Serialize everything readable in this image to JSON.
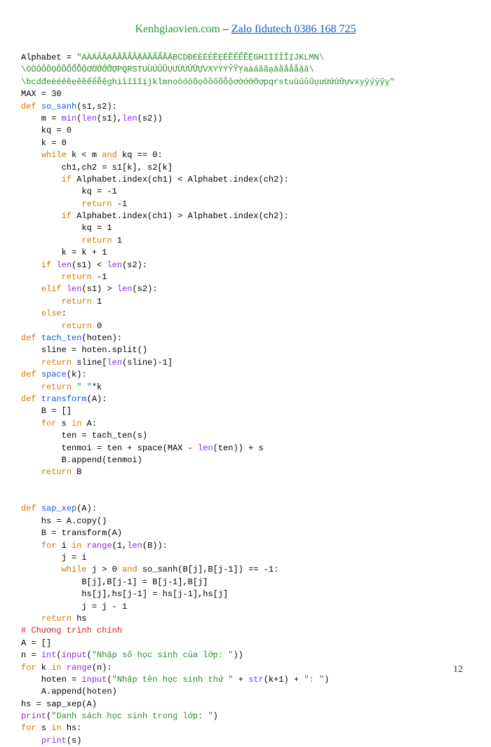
{
  "header": {
    "site": "Kenhgiaovien.com",
    "dash": " – ",
    "zalo": "Zalo fidutech 0386 168 725"
  },
  "code": {
    "tokens": [
      {
        "c": "s-plain",
        "t": "Alphabet = "
      },
      {
        "c": "s-str",
        "t": "\"AÀÁẢÃẠĂẰẮẲẴẶÂẦẤẨẪẬBCDĐEÈÉẺẼẸÊỀẾỂỄỆGHIÌÍỈĨỊJKLMN\\"
      },
      {
        "c": "nl"
      },
      {
        "c": "s-str",
        "t": "\\OÒÓỎÕỌÔỒỐỔỖỘƠỜỚỞỠỢPQRSTUÙÚỦŨỤƯỪỨỬỮỰVXYỲÝỶỸỴaàáảãạăằắẳẵặâ\\"
      },
      {
        "c": "nl"
      },
      {
        "c": "s-str",
        "t": "\\bcdđeèéẻẽẹêềếểễệghiìíỉĩịjklmnoòóỏõọôồốổỗộơờớởỡợpqrstuùúủũụưừứửữựvxyỳýỷỹỵ\""
      },
      {
        "c": "nl"
      },
      {
        "c": "s-plain",
        "t": "MAX = 30"
      },
      {
        "c": "nl"
      },
      {
        "c": "s-kw",
        "t": "def"
      },
      {
        "c": "s-plain",
        "t": " "
      },
      {
        "c": "s-fn",
        "t": "so_sanh"
      },
      {
        "c": "s-plain",
        "t": "(s1,s2):"
      },
      {
        "c": "nl"
      },
      {
        "c": "s-plain",
        "t": "    m = "
      },
      {
        "c": "s-bi",
        "t": "min"
      },
      {
        "c": "s-plain",
        "t": "("
      },
      {
        "c": "s-bi",
        "t": "len"
      },
      {
        "c": "s-plain",
        "t": "(s1),"
      },
      {
        "c": "s-bi",
        "t": "len"
      },
      {
        "c": "s-plain",
        "t": "(s2))"
      },
      {
        "c": "nl"
      },
      {
        "c": "s-plain",
        "t": "    kq = 0"
      },
      {
        "c": "nl"
      },
      {
        "c": "s-plain",
        "t": "    k = 0"
      },
      {
        "c": "nl"
      },
      {
        "c": "s-plain",
        "t": "    "
      },
      {
        "c": "s-kw",
        "t": "while"
      },
      {
        "c": "s-plain",
        "t": " k < m "
      },
      {
        "c": "s-kw",
        "t": "and"
      },
      {
        "c": "s-plain",
        "t": " kq == 0:"
      },
      {
        "c": "nl"
      },
      {
        "c": "s-plain",
        "t": "        ch1,ch2 = s1[k], s2[k]"
      },
      {
        "c": "nl"
      },
      {
        "c": "s-plain",
        "t": "        "
      },
      {
        "c": "s-kw",
        "t": "if"
      },
      {
        "c": "s-plain",
        "t": " Alphabet.index(ch1) < Alphabet.index(ch2):"
      },
      {
        "c": "nl"
      },
      {
        "c": "s-plain",
        "t": "            kq = -1"
      },
      {
        "c": "nl"
      },
      {
        "c": "s-plain",
        "t": "            "
      },
      {
        "c": "s-kw",
        "t": "return"
      },
      {
        "c": "s-plain",
        "t": " -1"
      },
      {
        "c": "nl"
      },
      {
        "c": "s-plain",
        "t": "        "
      },
      {
        "c": "s-kw",
        "t": "if"
      },
      {
        "c": "s-plain",
        "t": " Alphabet.index(ch1) > Alphabet.index(ch2):"
      },
      {
        "c": "nl"
      },
      {
        "c": "s-plain",
        "t": "            kq = 1"
      },
      {
        "c": "nl"
      },
      {
        "c": "s-plain",
        "t": "            "
      },
      {
        "c": "s-kw",
        "t": "return"
      },
      {
        "c": "s-plain",
        "t": " 1"
      },
      {
        "c": "nl"
      },
      {
        "c": "s-plain",
        "t": "        k = k + 1"
      },
      {
        "c": "nl"
      },
      {
        "c": "s-plain",
        "t": "    "
      },
      {
        "c": "s-kw",
        "t": "if"
      },
      {
        "c": "s-plain",
        "t": " "
      },
      {
        "c": "s-bi",
        "t": "len"
      },
      {
        "c": "s-plain",
        "t": "(s1) < "
      },
      {
        "c": "s-bi",
        "t": "len"
      },
      {
        "c": "s-plain",
        "t": "(s2):"
      },
      {
        "c": "nl"
      },
      {
        "c": "s-plain",
        "t": "        "
      },
      {
        "c": "s-kw",
        "t": "return"
      },
      {
        "c": "s-plain",
        "t": " -1"
      },
      {
        "c": "nl"
      },
      {
        "c": "s-plain",
        "t": "    "
      },
      {
        "c": "s-kw",
        "t": "elif"
      },
      {
        "c": "s-plain",
        "t": " "
      },
      {
        "c": "s-bi",
        "t": "len"
      },
      {
        "c": "s-plain",
        "t": "(s1) > "
      },
      {
        "c": "s-bi",
        "t": "len"
      },
      {
        "c": "s-plain",
        "t": "(s2):"
      },
      {
        "c": "nl"
      },
      {
        "c": "s-plain",
        "t": "        "
      },
      {
        "c": "s-kw",
        "t": "return"
      },
      {
        "c": "s-plain",
        "t": " 1"
      },
      {
        "c": "nl"
      },
      {
        "c": "s-plain",
        "t": "    "
      },
      {
        "c": "s-kw",
        "t": "else"
      },
      {
        "c": "s-plain",
        "t": ":"
      },
      {
        "c": "nl"
      },
      {
        "c": "s-plain",
        "t": "        "
      },
      {
        "c": "s-kw",
        "t": "return"
      },
      {
        "c": "s-plain",
        "t": " 0"
      },
      {
        "c": "nl"
      },
      {
        "c": "s-kw",
        "t": "def"
      },
      {
        "c": "s-plain",
        "t": " "
      },
      {
        "c": "s-fn",
        "t": "tach_ten"
      },
      {
        "c": "s-plain",
        "t": "(hoten):"
      },
      {
        "c": "nl"
      },
      {
        "c": "s-plain",
        "t": "    sline = hoten.split()"
      },
      {
        "c": "nl"
      },
      {
        "c": "s-plain",
        "t": "    "
      },
      {
        "c": "s-kw",
        "t": "return"
      },
      {
        "c": "s-plain",
        "t": " sline["
      },
      {
        "c": "s-bi",
        "t": "len"
      },
      {
        "c": "s-plain",
        "t": "(sline)-1]"
      },
      {
        "c": "nl"
      },
      {
        "c": "s-kw",
        "t": "def"
      },
      {
        "c": "s-plain",
        "t": " "
      },
      {
        "c": "s-fn",
        "t": "space"
      },
      {
        "c": "s-plain",
        "t": "(k):"
      },
      {
        "c": "nl"
      },
      {
        "c": "s-plain",
        "t": "    "
      },
      {
        "c": "s-kw",
        "t": "return"
      },
      {
        "c": "s-plain",
        "t": " "
      },
      {
        "c": "s-str",
        "t": "\" \""
      },
      {
        "c": "s-plain",
        "t": "*k"
      },
      {
        "c": "nl"
      },
      {
        "c": "s-kw",
        "t": "def"
      },
      {
        "c": "s-plain",
        "t": " "
      },
      {
        "c": "s-fn",
        "t": "transform"
      },
      {
        "c": "s-plain",
        "t": "(A):"
      },
      {
        "c": "nl"
      },
      {
        "c": "s-plain",
        "t": "    B = []"
      },
      {
        "c": "nl"
      },
      {
        "c": "s-plain",
        "t": "    "
      },
      {
        "c": "s-kw",
        "t": "for"
      },
      {
        "c": "s-plain",
        "t": " s "
      },
      {
        "c": "s-kw",
        "t": "in"
      },
      {
        "c": "s-plain",
        "t": " A:"
      },
      {
        "c": "nl"
      },
      {
        "c": "s-plain",
        "t": "        ten = tach_ten(s)"
      },
      {
        "c": "nl"
      },
      {
        "c": "s-plain",
        "t": "        tenmoi = ten + space(MAX - "
      },
      {
        "c": "s-bi",
        "t": "len"
      },
      {
        "c": "s-plain",
        "t": "(ten)) + s"
      },
      {
        "c": "nl"
      },
      {
        "c": "s-plain",
        "t": "        B.append(tenmoi)"
      },
      {
        "c": "nl"
      },
      {
        "c": "s-plain",
        "t": "    "
      },
      {
        "c": "s-kw",
        "t": "return"
      },
      {
        "c": "s-plain",
        "t": " B"
      },
      {
        "c": "nl"
      },
      {
        "c": "nl"
      },
      {
        "c": "nl"
      },
      {
        "c": "s-kw",
        "t": "def"
      },
      {
        "c": "s-plain",
        "t": " "
      },
      {
        "c": "s-fn",
        "t": "sap_xep"
      },
      {
        "c": "s-plain",
        "t": "(A):"
      },
      {
        "c": "nl"
      },
      {
        "c": "s-plain",
        "t": "    hs = A.copy()"
      },
      {
        "c": "nl"
      },
      {
        "c": "s-plain",
        "t": "    B = transform(A)"
      },
      {
        "c": "nl"
      },
      {
        "c": "s-plain",
        "t": "    "
      },
      {
        "c": "s-kw",
        "t": "for"
      },
      {
        "c": "s-plain",
        "t": " i "
      },
      {
        "c": "s-kw",
        "t": "in"
      },
      {
        "c": "s-plain",
        "t": " "
      },
      {
        "c": "s-bi",
        "t": "range"
      },
      {
        "c": "s-plain",
        "t": "(1,"
      },
      {
        "c": "s-bi",
        "t": "len"
      },
      {
        "c": "s-plain",
        "t": "(B)):"
      },
      {
        "c": "nl"
      },
      {
        "c": "s-plain",
        "t": "        j = i"
      },
      {
        "c": "nl"
      },
      {
        "c": "s-plain",
        "t": "        "
      },
      {
        "c": "s-kw",
        "t": "while"
      },
      {
        "c": "s-plain",
        "t": " j > 0 "
      },
      {
        "c": "s-kw",
        "t": "and"
      },
      {
        "c": "s-plain",
        "t": " so_sanh(B[j],B[j-1]) == -1:"
      },
      {
        "c": "nl"
      },
      {
        "c": "s-plain",
        "t": "            B[j],B[j-1] = B[j-1],B[j]"
      },
      {
        "c": "nl"
      },
      {
        "c": "s-plain",
        "t": "            hs[j],hs[j-1] = hs[j-1],hs[j]"
      },
      {
        "c": "nl"
      },
      {
        "c": "s-plain",
        "t": "            j = j - 1"
      },
      {
        "c": "nl"
      },
      {
        "c": "s-plain",
        "t": "    "
      },
      {
        "c": "s-kw",
        "t": "return"
      },
      {
        "c": "s-plain",
        "t": " hs"
      },
      {
        "c": "nl"
      },
      {
        "c": "s-cmt",
        "t": "# Chương trình chính"
      },
      {
        "c": "nl"
      },
      {
        "c": "s-plain",
        "t": "A = []"
      },
      {
        "c": "nl"
      },
      {
        "c": "s-plain",
        "t": "n = "
      },
      {
        "c": "s-bi",
        "t": "int"
      },
      {
        "c": "s-plain",
        "t": "("
      },
      {
        "c": "s-bi",
        "t": "input"
      },
      {
        "c": "s-plain",
        "t": "("
      },
      {
        "c": "s-str",
        "t": "\"Nhập số học sinh của lớp: \""
      },
      {
        "c": "s-plain",
        "t": "))"
      },
      {
        "c": "nl"
      },
      {
        "c": "s-kw",
        "t": "for"
      },
      {
        "c": "s-plain",
        "t": " k "
      },
      {
        "c": "s-kw",
        "t": "in"
      },
      {
        "c": "s-plain",
        "t": " "
      },
      {
        "c": "s-bi",
        "t": "range"
      },
      {
        "c": "s-plain",
        "t": "(n):"
      },
      {
        "c": "nl"
      },
      {
        "c": "s-plain",
        "t": "    hoten = "
      },
      {
        "c": "s-bi",
        "t": "input"
      },
      {
        "c": "s-plain",
        "t": "("
      },
      {
        "c": "s-str",
        "t": "\"Nhập tên học sinh thứ \""
      },
      {
        "c": "s-plain",
        "t": " + "
      },
      {
        "c": "s-bi",
        "t": "str"
      },
      {
        "c": "s-plain",
        "t": "(k+1) + "
      },
      {
        "c": "s-str",
        "t": "\": \""
      },
      {
        "c": "s-plain",
        "t": ")"
      },
      {
        "c": "nl"
      },
      {
        "c": "s-plain",
        "t": "    A.append(hoten)"
      },
      {
        "c": "nl"
      },
      {
        "c": "s-plain",
        "t": "hs = sap_xep(A)"
      },
      {
        "c": "nl"
      },
      {
        "c": "s-bi",
        "t": "print"
      },
      {
        "c": "s-plain",
        "t": "("
      },
      {
        "c": "s-str",
        "t": "\"Danh sách học sinh trong lớp: \""
      },
      {
        "c": "s-plain",
        "t": ")"
      },
      {
        "c": "nl"
      },
      {
        "c": "s-kw",
        "t": "for"
      },
      {
        "c": "s-plain",
        "t": " s "
      },
      {
        "c": "s-kw",
        "t": "in"
      },
      {
        "c": "s-plain",
        "t": " hs:"
      },
      {
        "c": "nl"
      },
      {
        "c": "s-plain",
        "t": "    "
      },
      {
        "c": "s-bi",
        "t": "print"
      },
      {
        "c": "s-plain",
        "t": "(s)"
      },
      {
        "c": "nl"
      }
    ]
  },
  "page_number": "12"
}
